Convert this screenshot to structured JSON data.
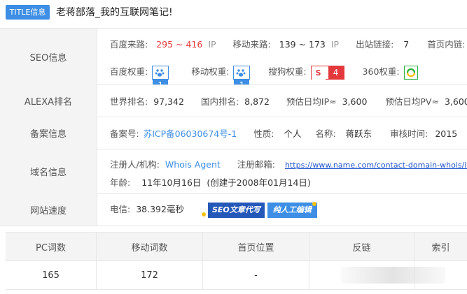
{
  "title": {
    "badge": "TITLE信息",
    "text": "老蒋部落_我的互联网笔记!"
  },
  "seo": {
    "label": "SEO信息",
    "baidu_source_label": "百度来路:",
    "baidu_source_value": "295 ~ 416",
    "baidu_source_unit": "IP",
    "mobile_source_label": "移动来路:",
    "mobile_source_value": "139 ~ 173",
    "mobile_source_unit": "IP",
    "outbound_label": "出站链接:",
    "outbound_value": "7",
    "home_inner_label": "首页内链:",
    "baidu_weight_label": "百度权重:",
    "baidu_weight_value": "1",
    "mobile_weight_label": "移动权重:",
    "mobile_weight_value": "1",
    "sogou_weight_label": "搜狗权重:",
    "sogou_weight_icon": "S",
    "sogou_weight_value": "4",
    "s360_weight_label": "360权重:",
    "icon_colors": {
      "baidu": "#3d8ee4",
      "sogou": "#e4393c",
      "s360": "#2db140"
    }
  },
  "alexa": {
    "label": "ALEXA排名",
    "world_label": "世界排名:",
    "world_value": "97,342",
    "domestic_label": "国内排名:",
    "domestic_value": "8,872",
    "est_ip_label": "预估日均IP≈",
    "est_ip_value": "3,600",
    "est_pv_label": "预估日均PV≈",
    "est_pv_value": "3,600"
  },
  "icp": {
    "label": "备案信息",
    "number_label": "备案号:",
    "number_value": "苏ICP备06030674号-1",
    "nature_label": "性质:",
    "nature_value": "个人",
    "name_label": "名称:",
    "name_value": "蒋跃东",
    "audit_label": "审核时间:",
    "audit_value": "2015"
  },
  "domain": {
    "label": "域名信息",
    "registrant_label": "注册人/机构:",
    "registrant_value": "Whois Agent",
    "email_label": "注册邮箱:",
    "email_value": "https://www.name.com/contact-domain-whois/itb",
    "age_label": "年龄:",
    "age_value": "11年10月16日",
    "created_text": "(创建于2008年01月14日)"
  },
  "speed": {
    "label": "网站速度",
    "telecom_label": "电信:",
    "telecom_value": "38.392毫秒",
    "banner_left": "SEO文章代写",
    "banner_right": "纯人工编辑"
  },
  "stats": {
    "headers": [
      "PC词数",
      "移动词数",
      "首页位置",
      "反链",
      "索引"
    ],
    "values": [
      "165",
      "172",
      "-",
      "",
      ""
    ]
  }
}
